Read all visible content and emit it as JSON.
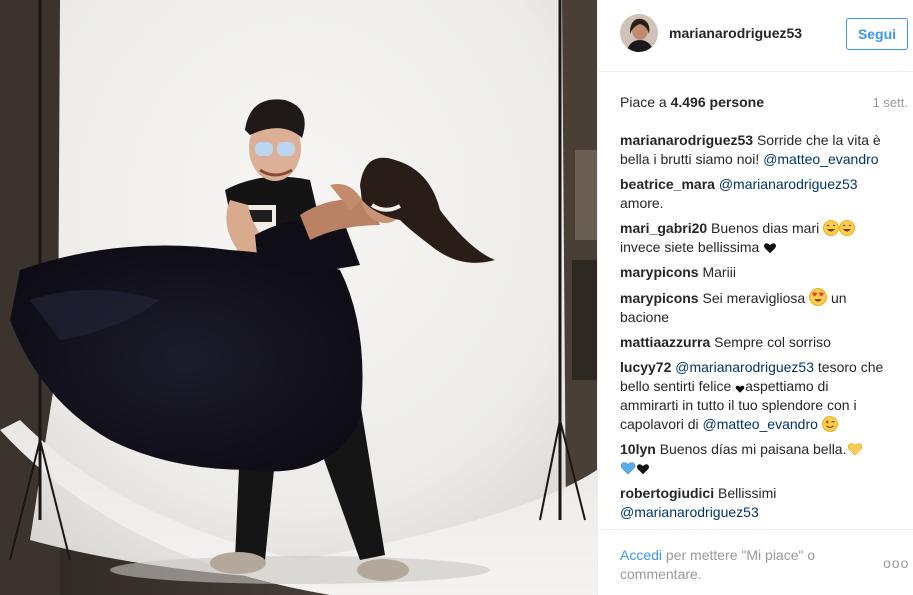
{
  "post": {
    "username": "marianarodriguez53",
    "follow_label": "Segui",
    "likes_prefix": "Piace a",
    "likes_count": "4.496",
    "likes_suffix": "persone",
    "time": "1 sett."
  },
  "comments": [
    {
      "user": "marianarodriguez53",
      "text": " Sorride che la vita è bella i brutti siamo noi! ",
      "mention": "@matteo_evandro"
    },
    {
      "user": "beatrice_mara",
      "mention": "@marianarodriguez53",
      "text": " amore."
    },
    {
      "user": "mari_gabri20",
      "text": " Buenos dias mari ",
      "text2": " invece siete bellissima "
    },
    {
      "user": "marypicons",
      "text": " Mariii"
    },
    {
      "user": "marypicons",
      "text": " Sei meravigliosa ",
      "text2": " un bacione"
    },
    {
      "user": "mattiaazzurra",
      "text": " Sempre col sorriso"
    },
    {
      "user": "lucyy72",
      "mention": "@marianarodriguez53",
      "text": " tesoro che bello sentirti felice ",
      "text2": "aspettiamo di ammirarti in tutto il tuo splendore con i capolavori di ",
      "mention2": "@matteo_evandro"
    },
    {
      "user": "10lyn",
      "text": " Buenos días mi paisana bella."
    },
    {
      "user": "robertogiudici",
      "text": " Bellissimi ",
      "mention": "@marianarodriguez53"
    }
  ],
  "footer": {
    "login_link": "Accedi",
    "login_text": " per mettere \"Mi piace\" o commentare.",
    "more": "ooo"
  },
  "icons": {
    "smile": "grinning-face-icon",
    "heart": "black-heart-icon",
    "heart_eyes": "heart-eyes-face-icon",
    "wink": "winking-face-icon",
    "yellow_heart": "yellow-heart-icon",
    "blue_heart": "blue-heart-icon"
  },
  "colors": {
    "accent": "#3897f0",
    "mention": "#003569",
    "muted": "#999999",
    "text": "#262626"
  }
}
